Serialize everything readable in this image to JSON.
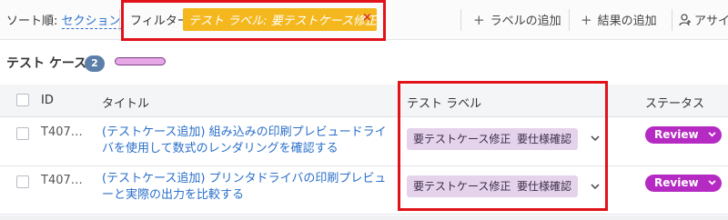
{
  "toolbar": {
    "sort_label": "ソート順:",
    "sort_value": "セクション",
    "filter_label": "フィルター:",
    "filter_chip": "テスト ラベル: 要テストケース修正",
    "filter_remove": "×",
    "add_label": "ラベルの追加",
    "add_result": "結果の追加",
    "assign": "アサイ",
    "plus": "+",
    "chip_color": "#f4b81e"
  },
  "section": {
    "title": "テスト ケース",
    "count": "2"
  },
  "table": {
    "headers": {
      "id": "ID",
      "title": "タイトル",
      "labels": "テスト ラベル",
      "status": "ステータス"
    },
    "rows": [
      {
        "id": "T407…",
        "title": "(テストケース追加) 組み込みの印刷プレビュードライバを使用して数式のレンダリングを確認する",
        "tags": [
          "要テストケース修正",
          "要仕様確認"
        ],
        "status": "Review"
      },
      {
        "id": "T407…",
        "title": "(テストケース追加) プリンタドライバの印刷プレビューと実際の出力を比較する",
        "tags": [
          "要テストケース修正",
          "要仕様確認"
        ],
        "status": "Review"
      }
    ]
  },
  "colors": {
    "accent": "#2a6fc9",
    "status_review": "#b52ac2",
    "tag_bg": "#e4d3ea",
    "highlight": "#e0121a"
  }
}
